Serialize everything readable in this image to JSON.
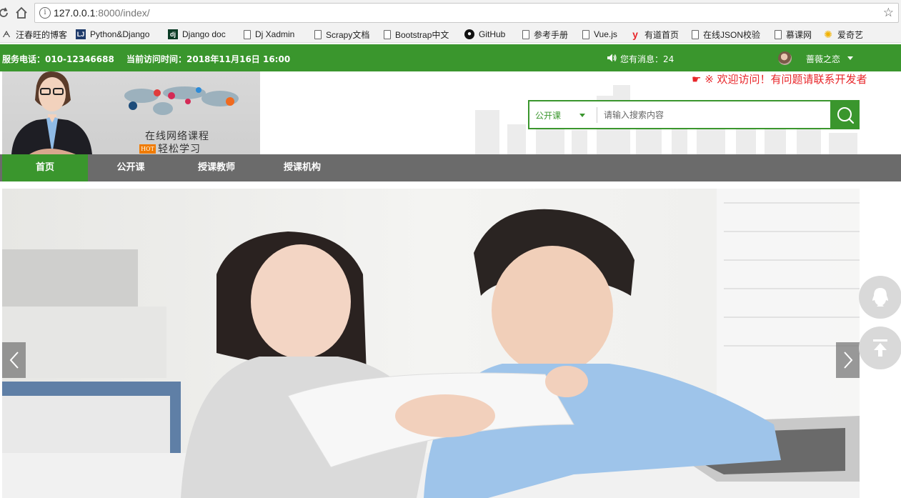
{
  "browser": {
    "url_host": "127.0.0.1",
    "url_rest": ":8000/index/",
    "bookmarks": [
      {
        "label": "汪春旺的博客",
        "icon": "user-icon"
      },
      {
        "label": "Python&Django",
        "icon": "lj-icon"
      },
      {
        "label": "Django doc",
        "icon": "dj-icon"
      },
      {
        "label": "Dj Xadmin",
        "icon": "page-icon"
      },
      {
        "label": "Scrapy文档",
        "icon": "page-icon"
      },
      {
        "label": "Bootstrap中文",
        "icon": "page-icon"
      },
      {
        "label": "GitHub",
        "icon": "github-icon"
      },
      {
        "label": "参考手册",
        "icon": "page-icon"
      },
      {
        "label": "Vue.js",
        "icon": "page-icon"
      },
      {
        "label": "有道首页",
        "icon": "youdao-icon"
      },
      {
        "label": "在线JSON校验",
        "icon": "page-icon"
      },
      {
        "label": "慕课网",
        "icon": "page-icon"
      },
      {
        "label": "爱奇艺",
        "icon": "iqiyi-icon"
      }
    ]
  },
  "topbar": {
    "phone": "服务电话：010-12346688",
    "visit_time": "当前访问时间：2018年11月16日 16:00",
    "messages": "您有消息：24",
    "username": "蔷薇之恋"
  },
  "header": {
    "logo_line1": "在线网络课程",
    "logo_line2": "轻松学习",
    "hot_badge": "HOT",
    "marquee": "☛ ※ 欢迎访问！有问题请联系开发者"
  },
  "search": {
    "category": "公开课",
    "placeholder": "请输入搜索内容"
  },
  "nav": {
    "items": [
      {
        "label": "首页",
        "active": true
      },
      {
        "label": "公开课",
        "active": false
      },
      {
        "label": "授课教师",
        "active": false
      },
      {
        "label": "授课机构",
        "active": false
      }
    ]
  },
  "colors": {
    "brand_green": "#3a962d",
    "nav_gray": "#6b6b6b",
    "marquee_red": "#e8262a"
  }
}
